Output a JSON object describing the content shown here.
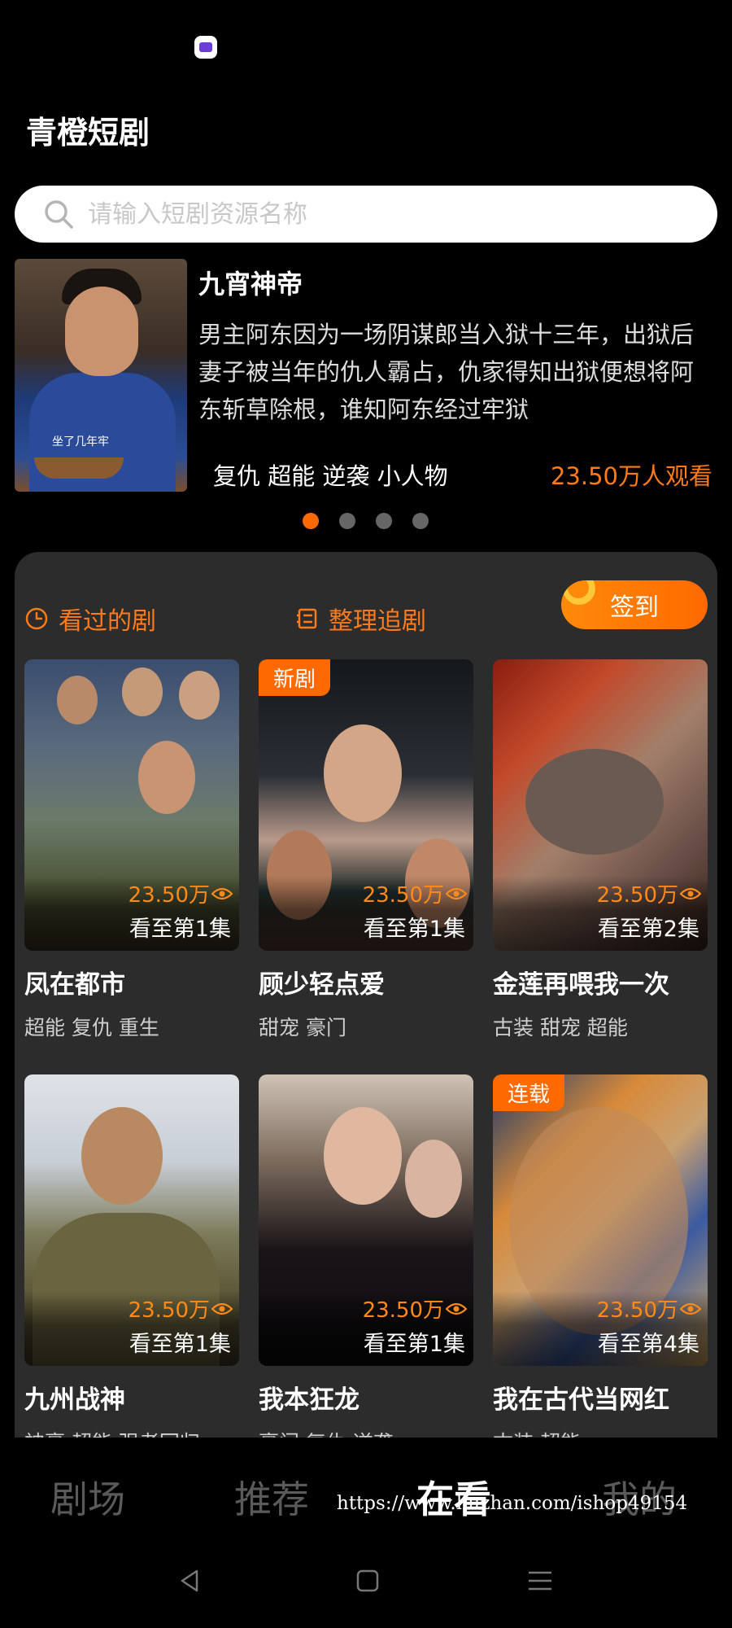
{
  "app": {
    "title": "青橙短剧"
  },
  "search": {
    "placeholder": "请输入短剧资源名称"
  },
  "banner": {
    "title": "九宵神帝",
    "description": "男主阿东因为一场阴谋郎当入狱十三年，出狱后妻子被当年的仇人霸占，仇家得知出狱便想将阿东斩草除根，谁知阿东经过牢狱",
    "tags": "复仇 超能 逆袭 小人物",
    "views": "23.50万人观看",
    "poster_caption": "坐了几年牢"
  },
  "carousel": {
    "total": 4,
    "active": 0
  },
  "quick_actions": {
    "history": "看过的剧",
    "follow": "整理追剧",
    "checkin": "签到"
  },
  "dramas": [
    {
      "title": "凤在都市",
      "tags": "超能 复仇 重生",
      "views": "23.50万",
      "progress": "看至第1集",
      "badge": ""
    },
    {
      "title": "顾少轻点爱",
      "tags": "甜宠 豪门",
      "views": "23.50万",
      "progress": "看至第1集",
      "badge": "新剧"
    },
    {
      "title": "金莲再喂我一次",
      "tags": "古装 甜宠 超能",
      "views": "23.50万",
      "progress": "看至第2集",
      "badge": ""
    },
    {
      "title": "九州战神",
      "tags": "神豪 超能 强者回归",
      "views": "23.50万",
      "progress": "看至第1集",
      "badge": ""
    },
    {
      "title": "我本狂龙",
      "tags": "豪门 复仇 逆袭",
      "views": "23.50万",
      "progress": "看至第1集",
      "badge": ""
    },
    {
      "title": "我在古代当网红",
      "tags": "古装 超能",
      "views": "23.50万",
      "progress": "看至第4集",
      "badge": "连载"
    }
  ],
  "tabs": [
    "剧场",
    "推荐",
    "在看",
    "我的"
  ],
  "active_tab": "在看",
  "watermark": "https://www.huzhan.com/ishop49154",
  "colors": {
    "accent": "#ff6a00",
    "panel": "#2c2c2c",
    "background": "#000000"
  },
  "icons": {
    "search": "search-icon",
    "history": "clock-icon",
    "follow": "list-icon",
    "views": "eye-icon"
  }
}
